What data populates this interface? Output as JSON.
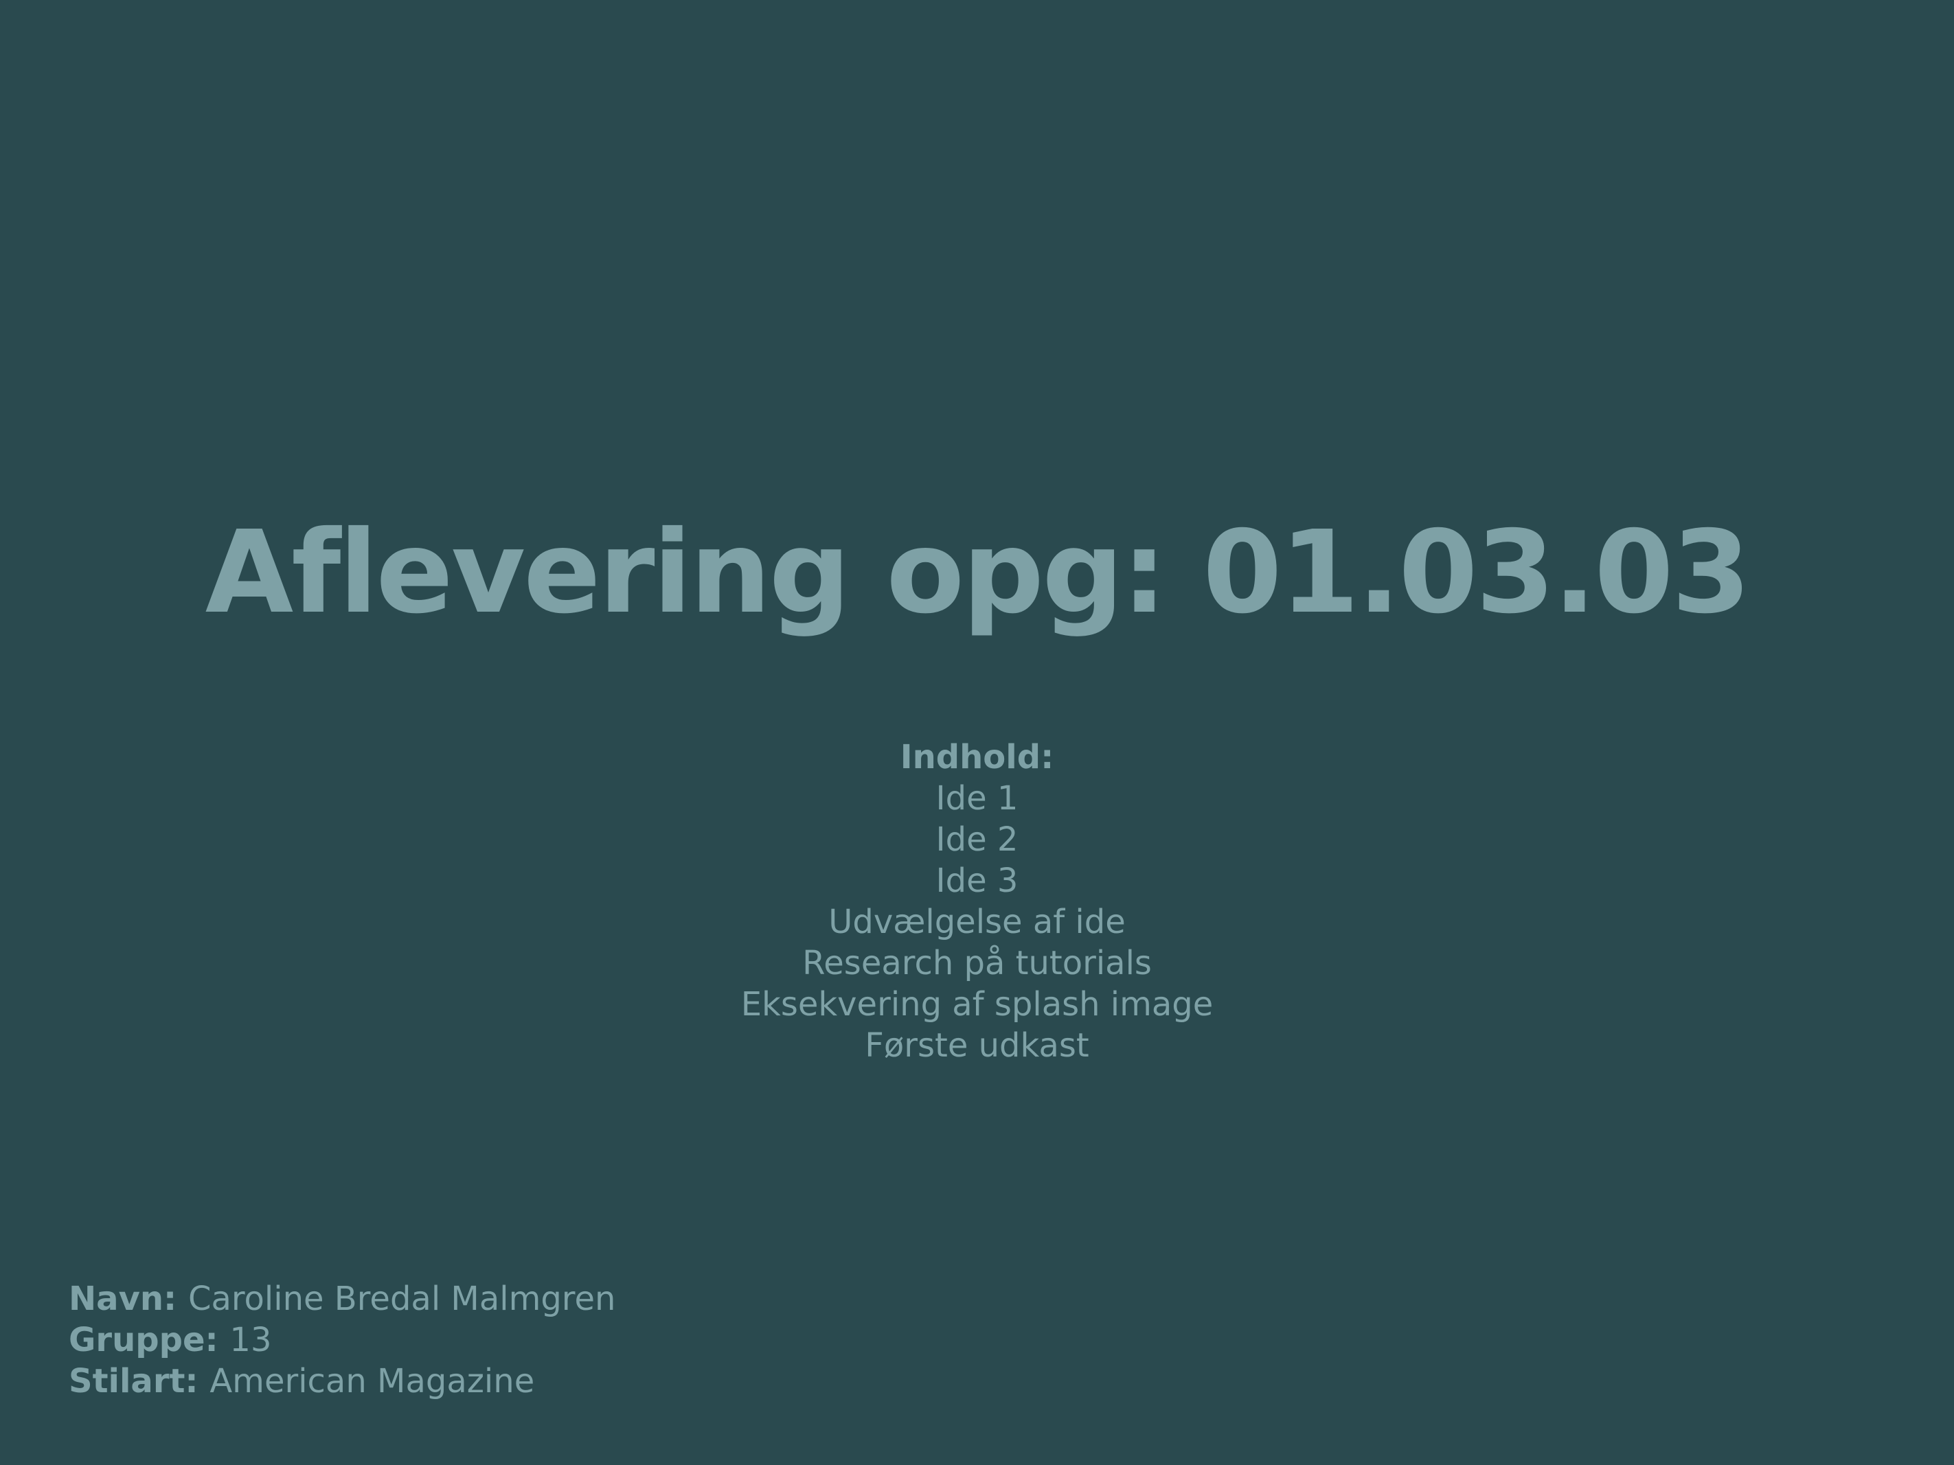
{
  "title": "Aflevering opg: 01.03.03",
  "contents": {
    "heading": "Indhold:",
    "items": [
      "Ide 1",
      "Ide 2",
      "Ide 3",
      "Udvælgelse af ide",
      "Research på tutorials",
      "Eksekvering af splash image",
      "Første udkast"
    ]
  },
  "meta": {
    "name_label": "Navn:",
    "name_value": "Caroline Bredal Malmgren",
    "group_label": "Gruppe:",
    "group_value": "13",
    "style_label": "Stilart:",
    "style_value": "American Magazine"
  },
  "colors": {
    "background": "#2a4a4f",
    "text": "#7ea1a6"
  }
}
